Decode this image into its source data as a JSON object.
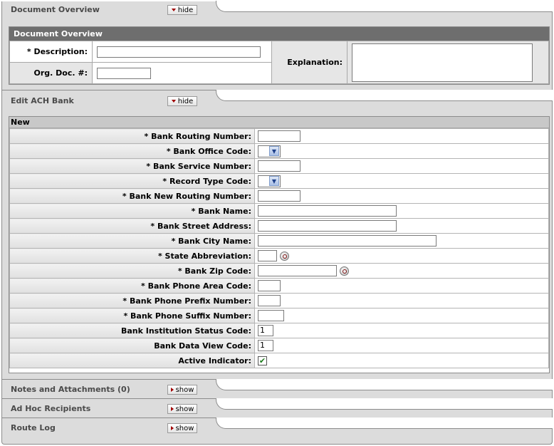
{
  "doc_overview_tab": {
    "title": "Document Overview",
    "toggle": "hide"
  },
  "doc_overview": {
    "header": "Document Overview",
    "description_label": "* Description:",
    "description_value": "",
    "org_doc_label": "Org. Doc. #:",
    "org_doc_value": "",
    "explanation_label": "Explanation:",
    "explanation_value": ""
  },
  "ach_tab": {
    "title": "Edit ACH Bank",
    "toggle": "hide"
  },
  "ach": {
    "section": "New",
    "fields": [
      {
        "label": "* Bank Routing Number:",
        "type": "text",
        "value": ""
      },
      {
        "label": "* Bank Office Code:",
        "type": "select",
        "value": ""
      },
      {
        "label": "* Bank Service Number:",
        "type": "text",
        "value": ""
      },
      {
        "label": "* Record Type Code:",
        "type": "select",
        "value": ""
      },
      {
        "label": "* Bank New Routing Number:",
        "type": "text",
        "value": ""
      },
      {
        "label": "* Bank Name:",
        "type": "text",
        "value": ""
      },
      {
        "label": "* Bank Street Address:",
        "type": "text",
        "value": ""
      },
      {
        "label": "* Bank City Name:",
        "type": "text",
        "value": ""
      },
      {
        "label": "* State Abbreviation:",
        "type": "text",
        "value": ""
      },
      {
        "label": "* Bank Zip Code:",
        "type": "text",
        "value": ""
      },
      {
        "label": "* Bank Phone Area Code:",
        "type": "text",
        "value": ""
      },
      {
        "label": "* Bank Phone Prefix Number:",
        "type": "text",
        "value": ""
      },
      {
        "label": "* Bank Phone Suffix Number:",
        "type": "text",
        "value": ""
      },
      {
        "label": "Bank Institution Status Code:",
        "type": "text",
        "value": "1"
      },
      {
        "label": "Bank Data View Code:",
        "type": "text",
        "value": "1"
      },
      {
        "label": "Active Indicator:",
        "type": "checkbox",
        "value": "✔"
      }
    ]
  },
  "notes_tab": {
    "title": "Notes and Attachments (0)",
    "toggle": "show"
  },
  "adhoc_tab": {
    "title": "Ad Hoc Recipients",
    "toggle": "show"
  },
  "route_tab": {
    "title": "Route Log",
    "toggle": "show"
  },
  "icons": {
    "lookup": "magnifier-lookup-icon",
    "select_arrow": "chevron-down-icon",
    "check": "checkmark-icon"
  }
}
